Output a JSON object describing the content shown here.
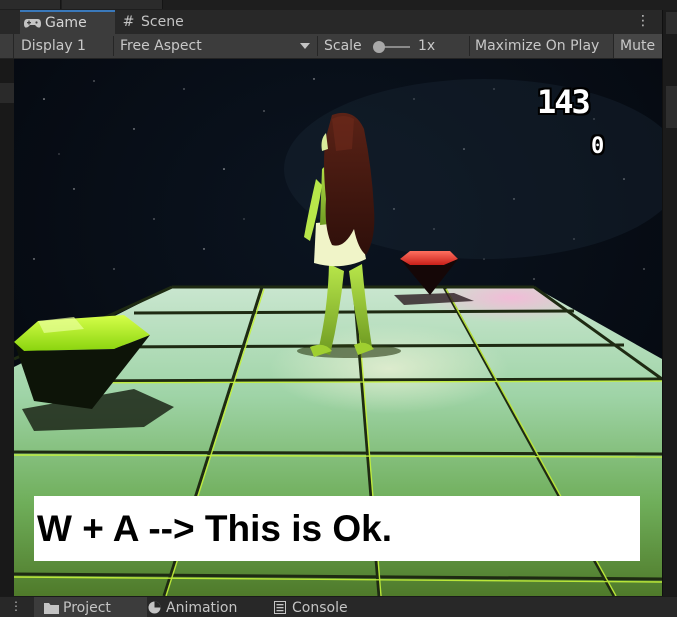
{
  "tabs": [
    {
      "label": "Game",
      "icon": "gamepad-icon"
    },
    {
      "label": "Scene",
      "icon": "grid-icon"
    }
  ],
  "toolbar": {
    "display": "Display 1",
    "aspect": "Free Aspect",
    "scale_label": "Scale",
    "scale_value": "1x",
    "scale_fraction": 0.0,
    "maximize_label": "Maximize On Play",
    "mute_label": "Mute"
  },
  "game": {
    "score": "143",
    "counter": "0",
    "caption": "W + A --> This is Ok."
  },
  "bottom_tabs": [
    {
      "label": "Project",
      "icon": "folder-icon"
    },
    {
      "label": "Animation",
      "icon": "animation-icon"
    },
    {
      "label": "Console",
      "icon": "console-icon"
    }
  ],
  "colors": {
    "accent": "#3a79bb",
    "panel_bg": "#282828",
    "toolbar_bg": "#3c3c3c",
    "green_gem": "#a8f01a",
    "red_gem": "#e8372e"
  }
}
